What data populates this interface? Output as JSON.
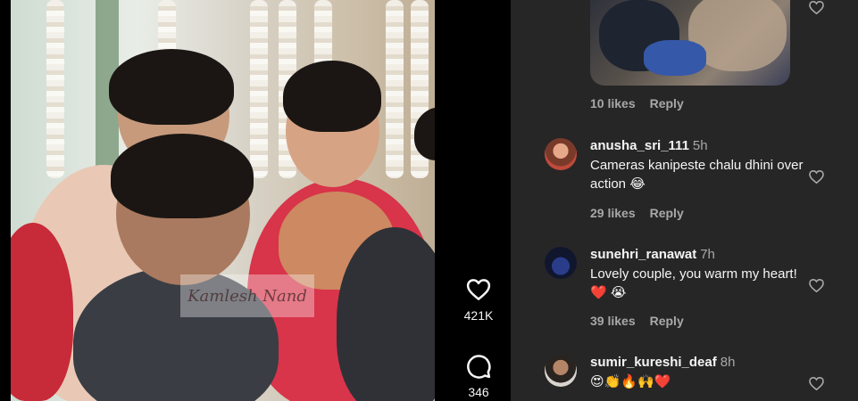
{
  "video": {
    "watermark_text": "Kamlesh Nand"
  },
  "actions": {
    "like": {
      "icon": "heart-icon",
      "count": "421K"
    },
    "comment": {
      "icon": "comment-icon",
      "count": "346"
    }
  },
  "comments_panel": {
    "previous_reply": {
      "likes": "10 likes",
      "reply_label": "Reply"
    },
    "comments": [
      {
        "username": "anusha_sri_111",
        "time": "5h",
        "text": "Cameras kanipeste chalu dhini over action 😂",
        "likes": "29 likes",
        "reply_label": "Reply"
      },
      {
        "username": "sunehri_ranawat",
        "time": "7h",
        "text": "Lovely couple, you warm my heart! ❤️ 😭",
        "likes": "39 likes",
        "reply_label": "Reply"
      },
      {
        "username": "sumir_kureshi_deaf",
        "time": "8h",
        "text": "😍👏🔥🙌❤️"
      }
    ]
  },
  "colors": {
    "panel_bg": "#262626",
    "secondary_text": "#a8a8a8",
    "primary_text": "#f5f5f5"
  }
}
